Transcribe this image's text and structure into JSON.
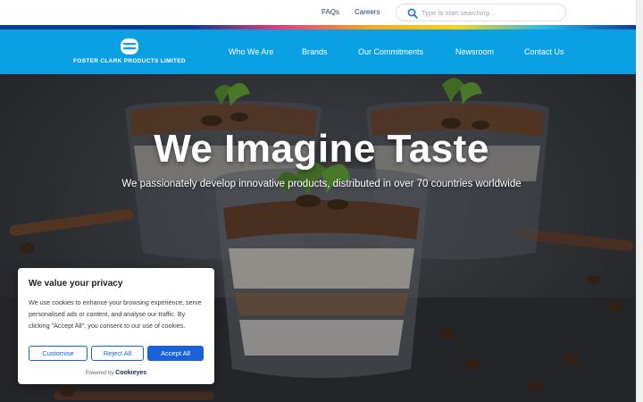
{
  "utility": {
    "faqs": "FAQs",
    "careers": "Careers",
    "search_placeholder": "Type to start searching..."
  },
  "brand": {
    "name": "FOSTER CLARK PRODUCTS LIMITED",
    "color": "#0b9fe3"
  },
  "nav": {
    "items": [
      {
        "label": "Who We Are"
      },
      {
        "label": "Brands"
      },
      {
        "label": "Our Commitments"
      },
      {
        "label": "Newsroom"
      },
      {
        "label": "Contact Us"
      }
    ]
  },
  "hero": {
    "title": "We Imagine Taste",
    "subtitle": "We passionately develop innovative products, distributed in over 70 countries worldwide",
    "image": "tiramisu-dessert-glasses"
  },
  "cookie": {
    "title": "We value your privacy",
    "text": "We use cookies to enhance your browsing experience, serve personalised ads or content, and analyse our traffic. By clicking \"Accept All\", you consent to our use of cookies.",
    "customise": "Customise",
    "reject": "Reject All",
    "accept": "Accept All",
    "powered_by": "Powered by",
    "powered_brand": "Cookieyes",
    "accent": "#1863dc"
  },
  "icons": {
    "search": "search-icon",
    "logo": "foster-clark-logo-icon"
  }
}
